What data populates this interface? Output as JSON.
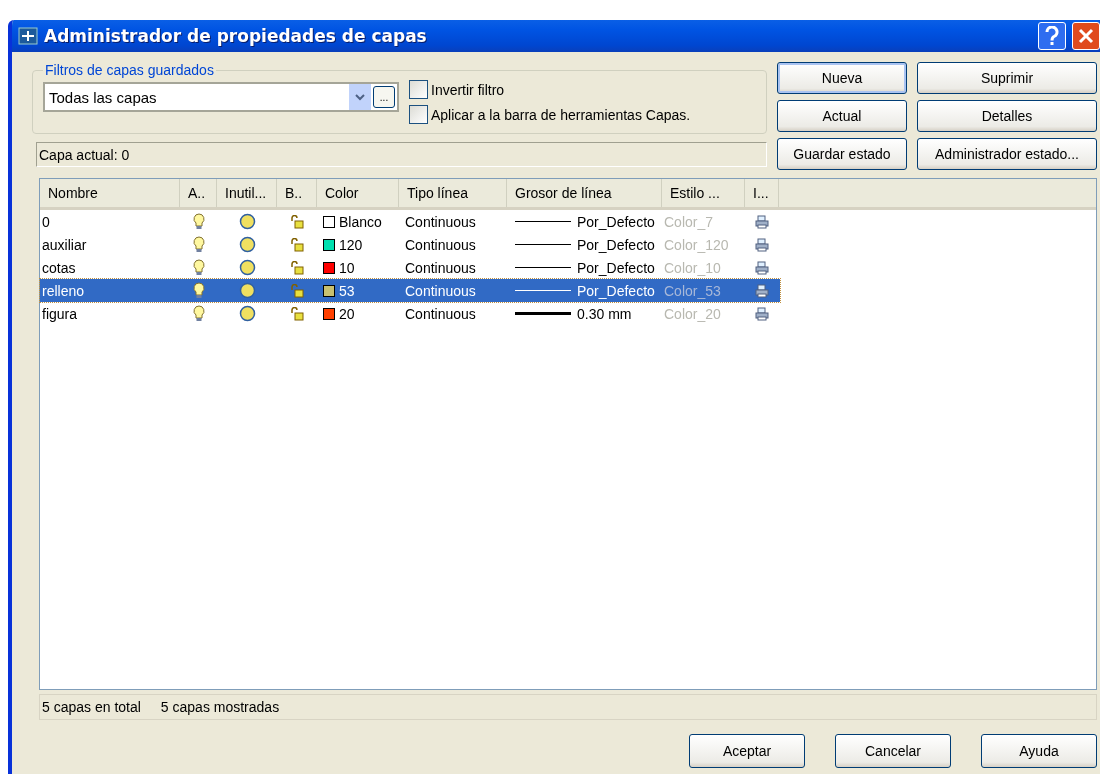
{
  "window": {
    "title": "Administrador de propiedades de capas"
  },
  "filters": {
    "legend": "Filtros de capas guardados",
    "value": "Todas las capas",
    "more_button": "...",
    "options": [
      {
        "label": "Invertir filtro",
        "checked": false
      },
      {
        "label": "Aplicar a la barra de herramientas Capas.",
        "checked": false
      }
    ]
  },
  "current_layer": "Capa actual:  0",
  "side_buttons": [
    {
      "label": "Nueva",
      "focused": true
    },
    {
      "label": "Suprimir",
      "focused": false
    },
    {
      "label": "Actual",
      "focused": false
    },
    {
      "label": "Detalles",
      "focused": false
    },
    {
      "label": "Guardar estado",
      "focused": false
    },
    {
      "label": "Administrador estado...",
      "focused": false
    }
  ],
  "table": {
    "columns": [
      "Nombre",
      "A..",
      "Inutil...",
      "B..",
      "Color",
      "Tipo línea",
      "Grosor de línea",
      "Estilo ...",
      "I..."
    ],
    "rows": [
      {
        "name": "0",
        "color": "#ffffff",
        "color_name": "Blanco",
        "linetype": "Continuous",
        "lineweight": "Por_Defecto",
        "kind": "thin",
        "plot_style": "Color_7",
        "selected": false
      },
      {
        "name": "auxiliar",
        "color": "#00e0b0",
        "color_name": "120",
        "linetype": "Continuous",
        "lineweight": "Por_Defecto",
        "kind": "thin",
        "plot_style": "Color_120",
        "selected": false
      },
      {
        "name": "cotas",
        "color": "#ff0000",
        "color_name": "10",
        "linetype": "Continuous",
        "lineweight": "Por_Defecto",
        "kind": "thin",
        "plot_style": "Color_10",
        "selected": false
      },
      {
        "name": "relleno",
        "color": "#c8c070",
        "color_name": "53",
        "linetype": "Continuous",
        "lineweight": "Por_Defecto",
        "kind": "thin",
        "plot_style": "Color_53",
        "selected": true
      },
      {
        "name": "figura",
        "color": "#ff4000",
        "color_name": "20",
        "linetype": "Continuous",
        "lineweight": "0.30 mm",
        "kind": "thick",
        "plot_style": "Color_20",
        "selected": false
      }
    ]
  },
  "status_bar": [
    "5 capas en total",
    "5 capas mostradas"
  ],
  "buttons": [
    "Aceptar",
    "Cancelar",
    "Ayuda"
  ]
}
